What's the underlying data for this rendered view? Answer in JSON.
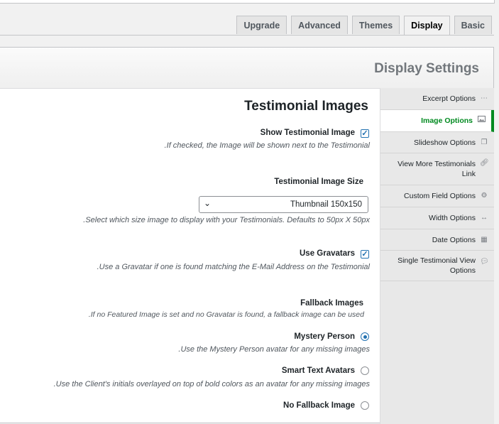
{
  "tabs": [
    "Basic",
    "Display",
    "Themes",
    "Advanced",
    "Upgrade"
  ],
  "active_tab": "Display",
  "panel_title": "Display Settings",
  "sidebar": {
    "items": [
      {
        "label": "Excerpt Options",
        "icon": "ellipsis-icon"
      },
      {
        "label": "Image Options",
        "icon": "image-icon",
        "active": true
      },
      {
        "label": "Slideshow Options",
        "icon": "slides-icon"
      },
      {
        "label": "View More Testimonials Link",
        "icon": "link-icon"
      },
      {
        "label": "Custom Field Options",
        "icon": "gears-icon"
      },
      {
        "label": "Width Options",
        "icon": "resize-icon"
      },
      {
        "label": "Date Options",
        "icon": "calendar-icon"
      },
      {
        "label": "Single Testimonial View Options",
        "icon": "comment-icon"
      }
    ]
  },
  "section_title": "Testimonial Images",
  "show_image": {
    "label": "Show Testimonial Image",
    "checked": true,
    "description": ".If checked, the Image will be shown next to the Testimonial"
  },
  "image_size": {
    "label": "Testimonial Image Size",
    "value": "Thumbnail 150x150",
    "description": ".Select which size image to display with your Testimonials. Defaults to 50px X 50px"
  },
  "gravatars": {
    "label": "Use Gravatars",
    "checked": true,
    "description": ".Use a Gravatar if one is found matching the E-Mail Address on the Testimonial"
  },
  "fallback": {
    "label": "Fallback Images",
    "description": ".If no Featured Image is set and no Gravatar is found, a fallback image can be used",
    "options": [
      {
        "label": "Mystery Person",
        "description": ".Use the Mystery Person avatar for any missing images",
        "selected": true
      },
      {
        "label": "Smart Text Avatars",
        "description": ".Use the Client's initials overlayed on top of bold colors as an avatar for any missing images",
        "selected": false
      },
      {
        "label": "No Fallback Image",
        "description": "",
        "selected": false
      }
    ]
  },
  "colors": {
    "accent": "#2271b1",
    "active_sidebar": "#008a20"
  }
}
